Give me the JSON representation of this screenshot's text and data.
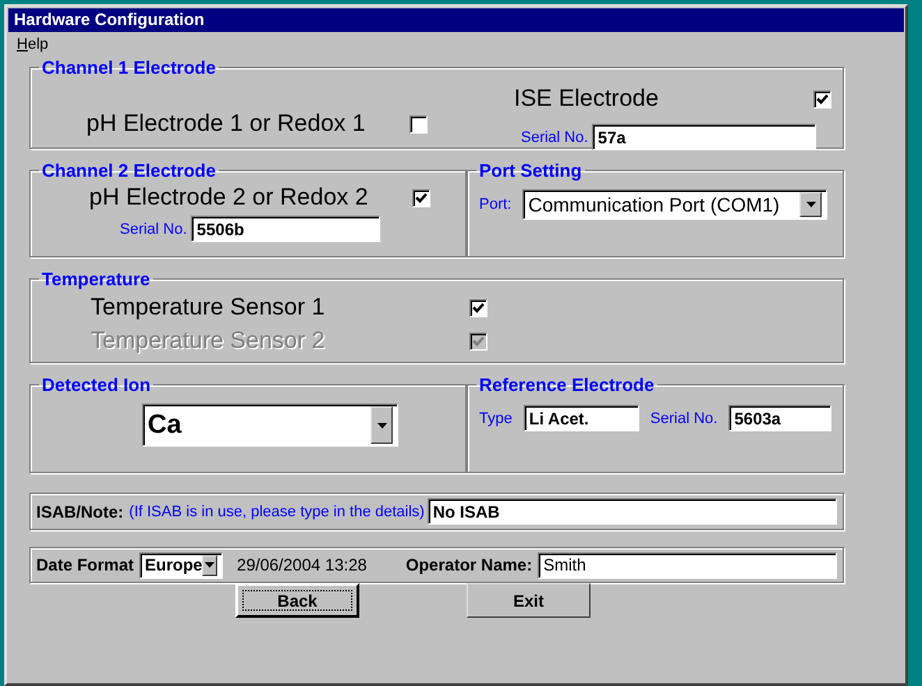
{
  "window": {
    "title": "Hardware Configuration"
  },
  "menu": [
    {
      "label": "Help"
    }
  ],
  "channel_1": {
    "title": "Channel 1 Electrode",
    "options": [
      {
        "label": "pH Electrode 1 or Redox 1",
        "checked": false
      },
      {
        "label": "ISE Electrode",
        "checked": true
      }
    ],
    "serial": {
      "label": "Serial No.",
      "value": "57a"
    }
  },
  "channel_2": {
    "title": "Channel 2 Electrode",
    "option": {
      "label": "pH Electrode 2 or Redox 2",
      "checked": true
    },
    "serial": {
      "label": "Serial No.",
      "value": "5506b"
    }
  },
  "port_setting": {
    "title": "Port Setting",
    "label": "Port:",
    "value": "Communication Port (COM1)"
  },
  "temperature": {
    "title": "Temperature",
    "sensors": [
      {
        "label": "Temperature Sensor 1",
        "checked": true,
        "disabled": false
      },
      {
        "label": "Temperature Sensor 2",
        "checked": true,
        "disabled": true
      }
    ]
  },
  "detected_ion": {
    "title": "Detected Ion",
    "value": "Ca"
  },
  "reference_electrode": {
    "title": "Reference Electrode",
    "type": {
      "label": "Type",
      "value": "Li Acet."
    },
    "serial": {
      "label": "Serial No.",
      "value": "5603a"
    }
  },
  "isab": {
    "label": "ISAB/Note:",
    "hint": "(If ISAB is in use, please type in the details)",
    "value": "No ISAB"
  },
  "footer": {
    "date_format": {
      "label": "Date Format",
      "value": "Europe"
    },
    "datetime": "29/06/2004 13:28",
    "operator": {
      "label": "Operator Name:",
      "value": "Smith"
    }
  },
  "buttons": [
    {
      "label": "Back",
      "focused": true
    },
    {
      "label": "Exit",
      "focused": false
    }
  ]
}
